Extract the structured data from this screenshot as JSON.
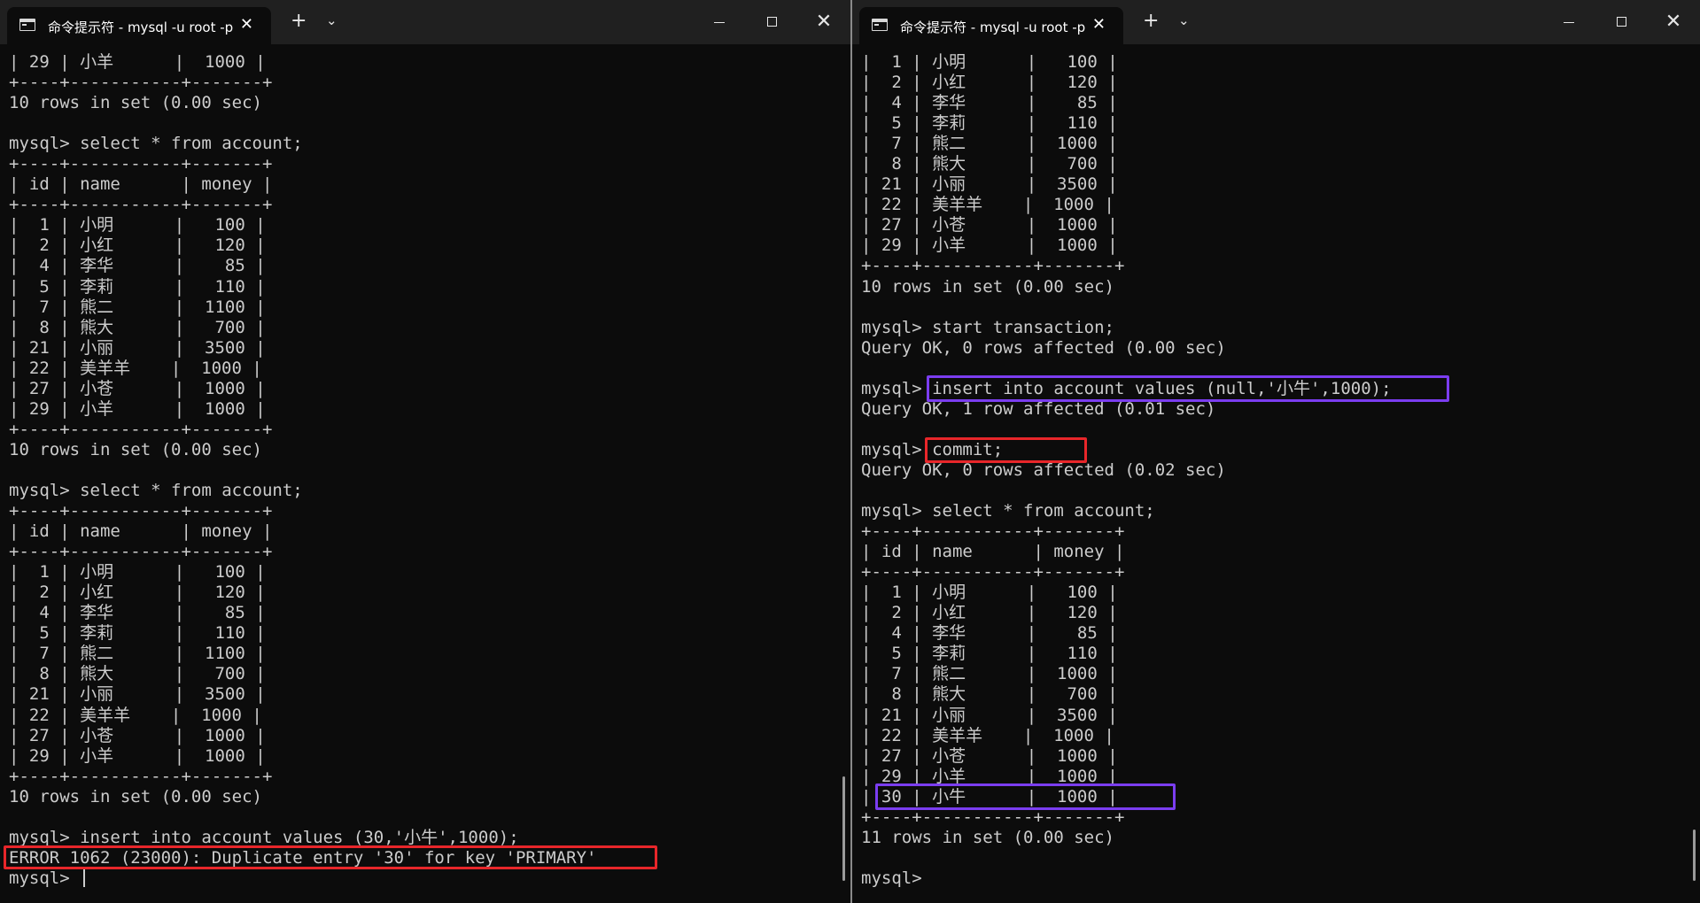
{
  "left_window": {
    "tab_title": "命令提示符 - mysql  -u root -p",
    "lines": [
      "| 29 | 小羊      |  1000 |",
      "+----+-----------+-------+",
      "10 rows in set (0.00 sec)",
      "",
      "mysql> select * from account;",
      "+----+-----------+-------+",
      "| id | name      | money |",
      "+----+-----------+-------+",
      "|  1 | 小明      |   100 |",
      "|  2 | 小红      |   120 |",
      "|  4 | 李华      |    85 |",
      "|  5 | 李莉      |   110 |",
      "|  7 | 熊二      |  1100 |",
      "|  8 | 熊大      |   700 |",
      "| 21 | 小丽      |  3500 |",
      "| 22 | 美羊羊    |  1000 |",
      "| 27 | 小苍      |  1000 |",
      "| 29 | 小羊      |  1000 |",
      "+----+-----------+-------+",
      "10 rows in set (0.00 sec)",
      "",
      "mysql> select * from account;",
      "+----+-----------+-------+",
      "| id | name      | money |",
      "+----+-----------+-------+",
      "|  1 | 小明      |   100 |",
      "|  2 | 小红      |   120 |",
      "|  4 | 李华      |    85 |",
      "|  5 | 李莉      |   110 |",
      "|  7 | 熊二      |  1100 |",
      "|  8 | 熊大      |   700 |",
      "| 21 | 小丽      |  3500 |",
      "| 22 | 美羊羊    |  1000 |",
      "| 27 | 小苍      |  1000 |",
      "| 29 | 小羊      |  1000 |",
      "+----+-----------+-------+",
      "10 rows in set (0.00 sec)",
      "",
      "mysql> insert into account values (30,'小牛',1000);",
      "ERROR 1062 (23000): Duplicate entry '30' for key 'PRIMARY'",
      "mysql> "
    ]
  },
  "right_window": {
    "tab_title": "命令提示符 - mysql  -u root -p",
    "lines": [
      "|  1 | 小明      |   100 |",
      "|  2 | 小红      |   120 |",
      "|  4 | 李华      |    85 |",
      "|  5 | 李莉      |   110 |",
      "|  7 | 熊二      |  1000 |",
      "|  8 | 熊大      |   700 |",
      "| 21 | 小丽      |  3500 |",
      "| 22 | 美羊羊    |  1000 |",
      "| 27 | 小苍      |  1000 |",
      "| 29 | 小羊      |  1000 |",
      "+----+-----------+-------+",
      "10 rows in set (0.00 sec)",
      "",
      "mysql> start transaction;",
      "Query OK, 0 rows affected (0.00 sec)",
      "",
      "mysql> insert into account values (null,'小牛',1000);",
      "Query OK, 1 row affected (0.01 sec)",
      "",
      "mysql> commit;",
      "Query OK, 0 rows affected (0.02 sec)",
      "",
      "mysql> select * from account;",
      "+----+-----------+-------+",
      "| id | name      | money |",
      "+----+-----------+-------+",
      "|  1 | 小明      |   100 |",
      "|  2 | 小红      |   120 |",
      "|  4 | 李华      |    85 |",
      "|  5 | 李莉      |   110 |",
      "|  7 | 熊二      |  1000 |",
      "|  8 | 熊大      |   700 |",
      "| 21 | 小丽      |  3500 |",
      "| 22 | 美羊羊    |  1000 |",
      "| 27 | 小苍      |  1000 |",
      "| 29 | 小羊      |  1000 |",
      "| 30 | 小牛      |  1000 |",
      "+----+-----------+-------+",
      "11 rows in set (0.00 sec)",
      "",
      "mysql> "
    ]
  },
  "icons": {
    "tab": "terminal-icon",
    "close_tab": "close-icon",
    "new_tab": "plus-icon",
    "dropdown": "chevron-down-icon",
    "minimize": "minimize-icon",
    "maximize": "maximize-icon",
    "close_window": "close-icon"
  },
  "glyphs": {
    "tab_close": "✕",
    "new_tab": "+",
    "dropdown": "⌄",
    "close_window": "✕"
  },
  "colors": {
    "terminal_bg": "#0c0c0c",
    "terminal_text": "#cccccc",
    "titlebar_bg": "#202020",
    "highlight_red": "#e8262a",
    "highlight_purple": "#7b3df0"
  }
}
